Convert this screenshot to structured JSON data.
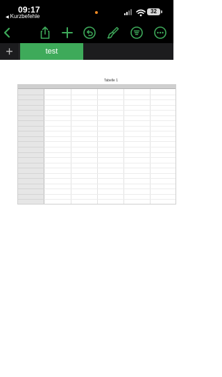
{
  "status": {
    "time": "09:17",
    "back_app": "Kurzbefehle",
    "back_arrow": "◀",
    "battery": "32",
    "icons": [
      "cellular-signal-icon",
      "wifi-icon",
      "battery-icon"
    ]
  },
  "toolbar": {
    "accent": "#3eaa5a",
    "icons": [
      "back-chevron-icon",
      "share-icon",
      "plus-icon",
      "undo-icon",
      "format-brush-icon",
      "organize-icon",
      "more-icon"
    ]
  },
  "sheets": {
    "add_label": "+",
    "tabs": [
      {
        "label": "test",
        "active": true
      }
    ]
  },
  "table": {
    "title": "Tabelle 1",
    "body_rows": 22,
    "body_cols": 5
  }
}
